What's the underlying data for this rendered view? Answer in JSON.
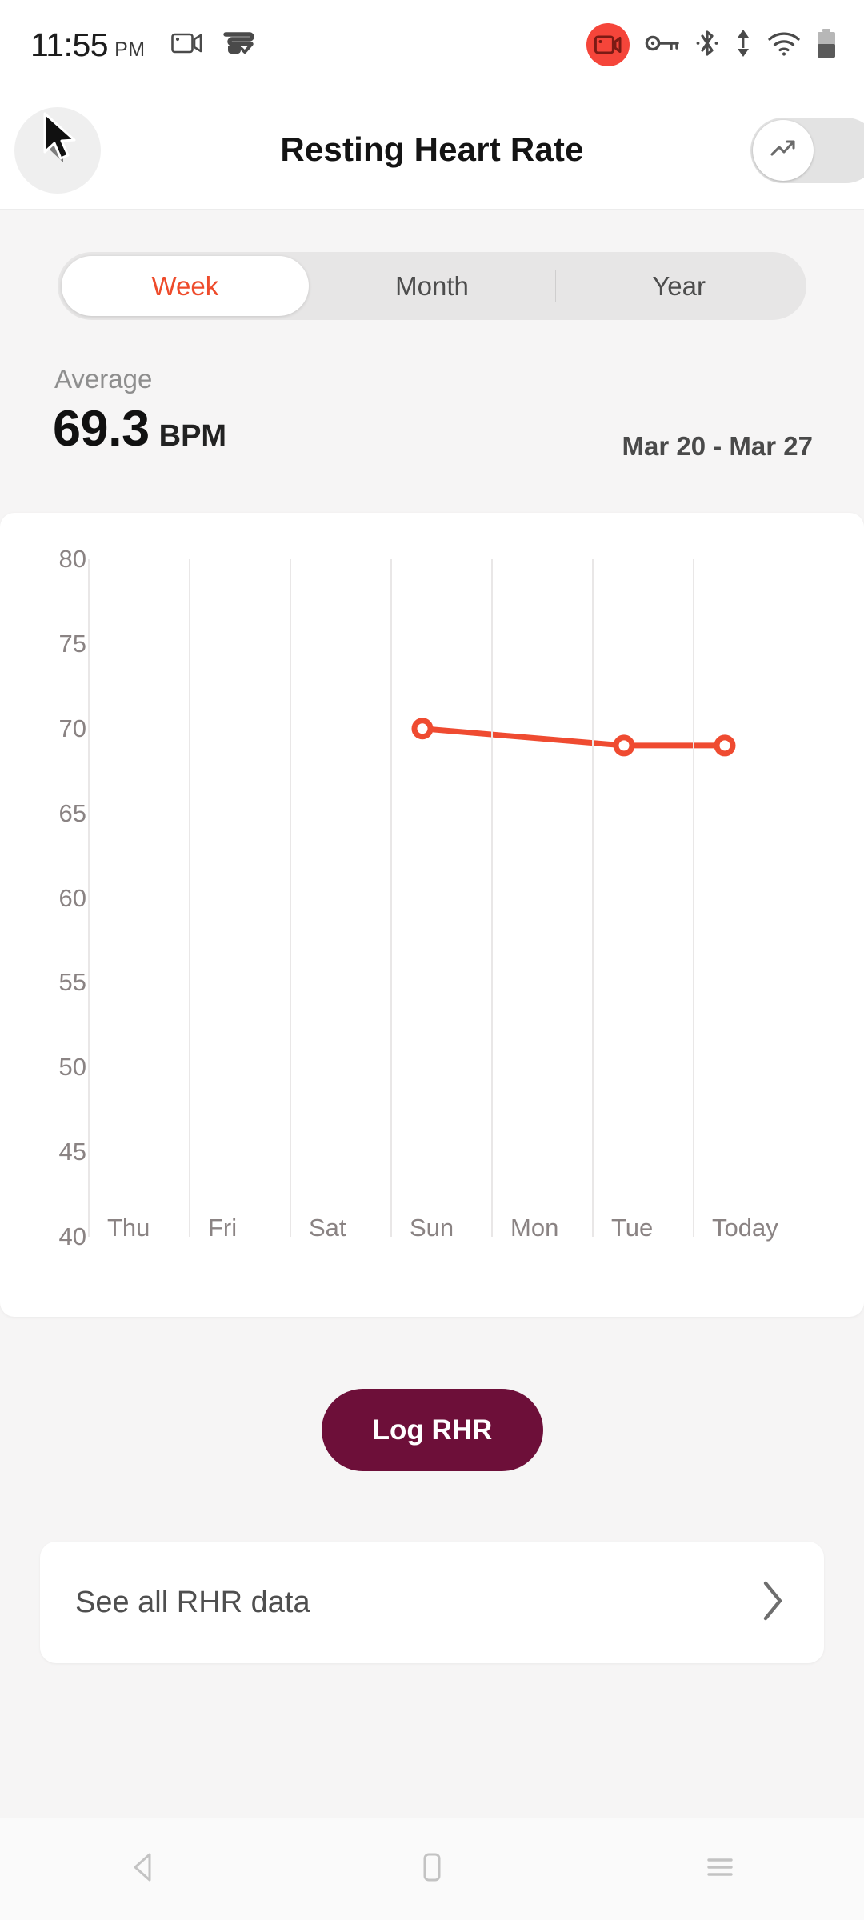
{
  "status_bar": {
    "time": "11:55",
    "ampm": "PM",
    "left_icons": [
      "video-camera-icon",
      "vr-headset-check-icon"
    ],
    "right_icons": [
      "screen-record-icon",
      "vpn-key-icon",
      "bluetooth-icon",
      "data-transfer-icon",
      "wifi-icon",
      "battery-icon"
    ],
    "record_badge_color": "#f5453a"
  },
  "app_bar": {
    "title": "Resting Heart Rate",
    "back_icon": "back-arrow-icon",
    "toggle_icon": "trending-up-icon",
    "toggle_state": "off"
  },
  "segmented": {
    "tabs": [
      {
        "label": "Week",
        "selected": true
      },
      {
        "label": "Month",
        "selected": false
      },
      {
        "label": "Year",
        "selected": false
      }
    ],
    "accent_color": "#ee4b2b"
  },
  "summary": {
    "average_label": "Average",
    "average_value": "69.3",
    "unit": "BPM",
    "date_range": "Mar 20 - Mar 27"
  },
  "chart_data": {
    "type": "line",
    "title": "",
    "xlabel": "",
    "ylabel": "",
    "categories": [
      "Thu",
      "Fri",
      "Sat",
      "Sun",
      "Mon",
      "Tue",
      "Today"
    ],
    "series": [
      {
        "name": "Resting Heart Rate",
        "color": "#ef4b31",
        "values": [
          null,
          null,
          null,
          70.0,
          null,
          69.0,
          69.0
        ]
      }
    ],
    "yticks": [
      80,
      75,
      70,
      65,
      60,
      55,
      50,
      45,
      40
    ],
    "ylim": [
      40,
      80
    ],
    "grid": true,
    "legend": "none",
    "marker": "open-circle"
  },
  "log_button": {
    "label": "Log RHR",
    "color": "#6d0f39"
  },
  "see_all": {
    "label": "See all RHR data",
    "chevron_icon": "chevron-right-icon"
  },
  "nav_bar": {
    "items": [
      "back-triangle-icon",
      "home-square-icon",
      "recents-lines-icon"
    ]
  }
}
